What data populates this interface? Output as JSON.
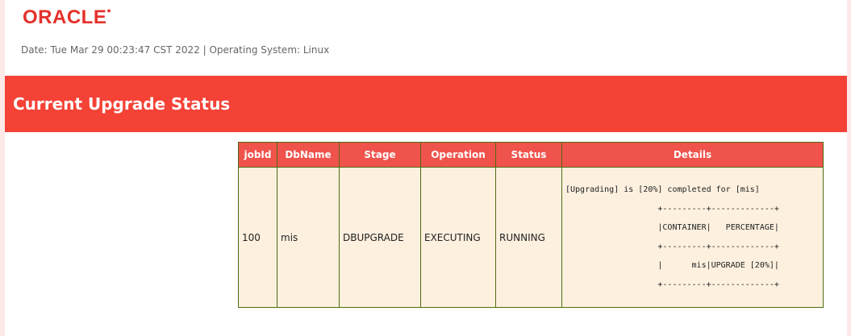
{
  "logo_text": "ORACLE",
  "meta_text": "Date: Tue Mar 29 00:23:47 CST 2022 | Operating System: Linux",
  "banner_title": "Current Upgrade Status",
  "table": {
    "headers": {
      "jobid": "jobId",
      "dbname": "DbName",
      "stage": "Stage",
      "operation": "Operation",
      "status": "Status",
      "details": "Details"
    },
    "row": {
      "jobid": "100",
      "dbname": "mis",
      "stage": "DBUPGRADE",
      "operation": "EXECUTING",
      "status": "RUNNING",
      "details": "[Upgrading] is [20%] completed for [mis]\n                   +---------+-------------+\n                   |CONTAINER|   PERCENTAGE|\n                   +---------+-------------+\n                   |      mis|UPGRADE [20%]|\n                   +---------+-------------+"
    }
  }
}
